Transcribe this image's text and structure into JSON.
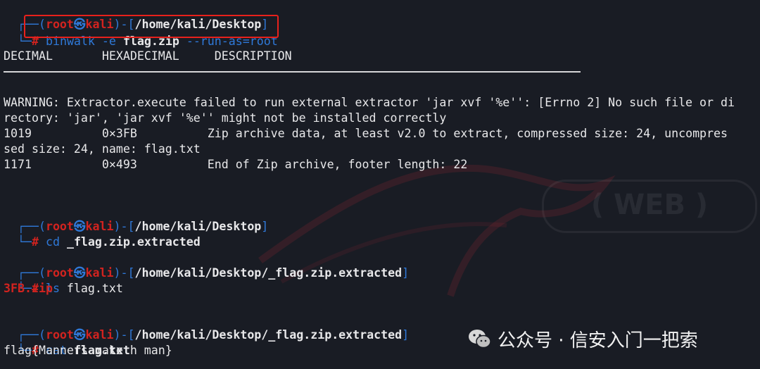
{
  "session1": {
    "prompt": {
      "open": "┌──(",
      "user": "root",
      "skull": "㉿",
      "host": "kali",
      "mid": ")-[",
      "path": "/home/kali/Desktop",
      "close": "]",
      "corner": "└─",
      "hash": "#"
    },
    "command": {
      "program": "binwalk",
      "flag": "-e",
      "file": "flag.zip",
      "option": "--run-as=root"
    }
  },
  "table_header": {
    "col1": "DECIMAL",
    "col2": "HEXADECIMAL",
    "col3": "DESCRIPTION"
  },
  "output": {
    "warning_1": "WARNING: Extractor.execute failed to run external extractor 'jar xvf '%e'': [Errno 2] No such file or di",
    "warning_2": "rectory: 'jar', 'jar xvf '%e'' might not be installed correctly",
    "row1_decimal": "1019",
    "row1_hex": "0×3FB",
    "row1_desc": "Zip archive data, at least v2.0 to extract, compressed size: 24, uncompres",
    "row1_desc_cont": "sed size: 24, name: flag.txt",
    "row2_decimal": "1171",
    "row2_hex": "0×493",
    "row2_desc": "End of Zip archive, footer length: 22"
  },
  "session2": {
    "path": "/home/kali/Desktop",
    "command": "cd",
    "arg": "_flag.zip.extracted"
  },
  "session3": {
    "path": "/home/kali/Desktop/_flag.zip.extracted",
    "command": "ls",
    "file1": "3FB.zip",
    "file2": "flag.txt"
  },
  "session4": {
    "path": "/home/kali/Desktop/_flag.zip.extracted",
    "command": "cat",
    "arg": "flag.txt",
    "result": "flag{Manners maketh man}"
  },
  "watermark": {
    "text": "公众号 · 信安入门一把索"
  },
  "colors": {
    "background": "#191c24",
    "prompt_blue": "#2f79d9",
    "prompt_red": "#d2231f",
    "highlight_box": "#e8211c"
  }
}
